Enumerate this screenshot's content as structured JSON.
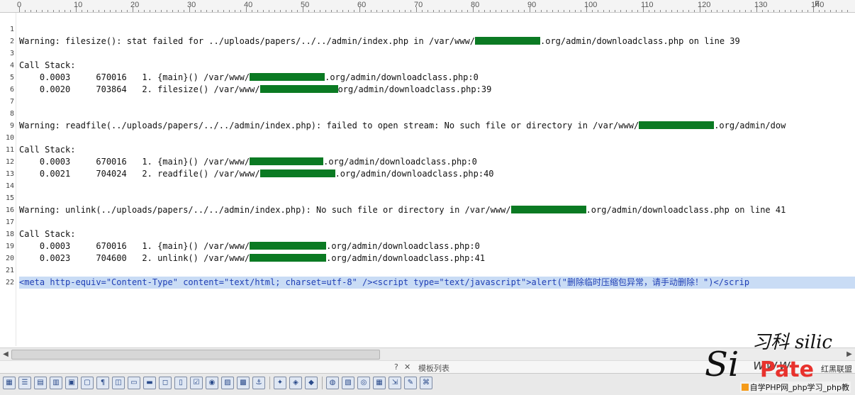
{
  "ruler": {
    "labels": [
      "0",
      "10",
      "20",
      "30",
      "40",
      "50",
      "60",
      "70",
      "80",
      "90",
      "100",
      "110",
      "120",
      "130",
      "140"
    ],
    "end_marker": "F"
  },
  "editor": {
    "redact_color": "#0b7a23",
    "lines": [
      {
        "n": "1",
        "segments": []
      },
      {
        "n": "2",
        "segments": [
          {
            "t": "Warning: filesize(): stat failed for ../uploads/papers/../../admin/index.php in /var/www/"
          },
          {
            "r": true,
            "w": 92
          },
          {
            "t": ".org/admin/downloadclass.php on line 39"
          }
        ]
      },
      {
        "n": "3",
        "segments": []
      },
      {
        "n": "4",
        "segments": [
          {
            "t": "Call Stack:"
          }
        ]
      },
      {
        "n": "5",
        "segments": [
          {
            "t": "    0.0003     670016   1. {main}() /var/www/"
          },
          {
            "r": true,
            "w": 106
          },
          {
            "t": ".org/admin/downloadclass.php:0"
          }
        ]
      },
      {
        "n": "6",
        "segments": [
          {
            "t": "    0.0020     703864   2. filesize() /var/www/"
          },
          {
            "r": true,
            "w": 110
          },
          {
            "t": "org/admin/downloadclass.php:39"
          }
        ]
      },
      {
        "n": "7",
        "segments": []
      },
      {
        "n": "8",
        "segments": []
      },
      {
        "n": "9",
        "segments": [
          {
            "t": "Warning: readfile(../uploads/papers/../../admin/index.php): failed to open stream: No such file or directory in /var/www/"
          },
          {
            "r": true,
            "w": 106
          },
          {
            "t": ".org/admin/dow"
          }
        ]
      },
      {
        "n": "10",
        "segments": []
      },
      {
        "n": "11",
        "segments": [
          {
            "t": "Call Stack:"
          }
        ]
      },
      {
        "n": "12",
        "segments": [
          {
            "t": "    0.0003     670016   1. {main}() /var/www/"
          },
          {
            "r": true,
            "w": 104
          },
          {
            "t": ".org/admin/downloadclass.php:0"
          }
        ]
      },
      {
        "n": "13",
        "segments": [
          {
            "t": "    0.0021     704024   2. readfile() /var/www/"
          },
          {
            "r": true,
            "w": 106
          },
          {
            "t": ".org/admin/downloadclass.php:40"
          }
        ]
      },
      {
        "n": "14",
        "segments": []
      },
      {
        "n": "15",
        "segments": []
      },
      {
        "n": "16",
        "segments": [
          {
            "t": "Warning: unlink(../uploads/papers/../../admin/index.php): No such file or directory in /var/www/"
          },
          {
            "r": true,
            "w": 106
          },
          {
            "t": ".org/admin/downloadclass.php on line 41"
          }
        ]
      },
      {
        "n": "17",
        "segments": []
      },
      {
        "n": "18",
        "segments": [
          {
            "t": "Call Stack:"
          }
        ]
      },
      {
        "n": "19",
        "segments": [
          {
            "t": "    0.0003     670016   1. {main}() /var/www/"
          },
          {
            "r": true,
            "w": 108
          },
          {
            "t": ".org/admin/downloadclass.php:0"
          }
        ]
      },
      {
        "n": "20",
        "segments": [
          {
            "t": "    0.0023     704600   2. unlink() /var/www/"
          },
          {
            "r": true,
            "w": 108
          },
          {
            "t": ".org/admin/downloadclass.php:41"
          }
        ]
      },
      {
        "n": "21",
        "segments": []
      },
      {
        "n": "22",
        "selected": true,
        "segments": [
          {
            "t": "<meta http-equiv=\"Content-Type\" content=\"text/html; charset=utf-8\" /><script type=\"text/javascript\">alert(\"删除临时压缩包异常，请手动删除！\")</scrip"
          }
        ]
      }
    ]
  },
  "panel": {
    "title": "模板列表"
  },
  "toolbar": {
    "icons": [
      "table-icon",
      "list-icon",
      "form-icon",
      "grid-icon",
      "image-icon",
      "frame-icon",
      "paragraph-icon",
      "layer-icon",
      "button-icon",
      "textfield-icon",
      "hidden-field-icon",
      "textarea-icon",
      "checkbox-icon",
      "radio-icon",
      "image-button-icon",
      "media-icon",
      "anchor-icon",
      "flash-icon",
      "applet-icon",
      "plugin-icon",
      "color-wheel-icon",
      "document-icon",
      "browse-icon",
      "table-properties-icon",
      "export-icon",
      "wand-icon",
      "script-icon"
    ]
  },
  "watermark": {
    "chars_top": "习科 silic",
    "chars_left": "Si",
    "chars_mid": "www",
    "brand": "Pate",
    "side": "红黑联盟",
    "bottom": "自学PHP网_php学习_php教"
  }
}
